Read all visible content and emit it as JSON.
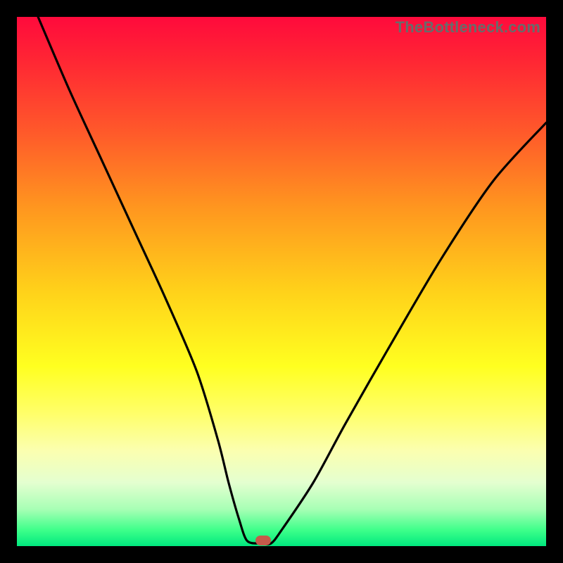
{
  "watermark": "TheBottleneck.com",
  "chart_data": {
    "type": "line",
    "title": "",
    "xlabel": "",
    "ylabel": "",
    "xlim": [
      0,
      100
    ],
    "ylim": [
      0,
      100
    ],
    "grid": false,
    "series": [
      {
        "name": "curve",
        "x": [
          4,
          10,
          16,
          22,
          28,
          34,
          38,
          40,
          42,
          43.5,
          46,
          48,
          50,
          56,
          62,
          70,
          80,
          90,
          100
        ],
        "values": [
          100,
          86,
          73,
          60,
          47,
          33,
          20,
          12,
          5,
          1,
          0.5,
          0.5,
          3,
          12,
          23,
          37,
          54,
          69,
          80
        ]
      }
    ],
    "marker": {
      "x": 46.5,
      "y_percent_from_top": 99,
      "color": "#c65a4a"
    },
    "gradient_stops": [
      {
        "pos": 0,
        "color": "#ff0a3c"
      },
      {
        "pos": 8,
        "color": "#ff2534"
      },
      {
        "pos": 22,
        "color": "#ff5a2a"
      },
      {
        "pos": 36,
        "color": "#ff961f"
      },
      {
        "pos": 52,
        "color": "#ffd21a"
      },
      {
        "pos": 66,
        "color": "#ffff20"
      },
      {
        "pos": 75,
        "color": "#ffff6a"
      },
      {
        "pos": 82,
        "color": "#fbffb0"
      },
      {
        "pos": 88,
        "color": "#e4ffd0"
      },
      {
        "pos": 93,
        "color": "#a8ffb5"
      },
      {
        "pos": 97,
        "color": "#3dff8a"
      },
      {
        "pos": 100,
        "color": "#00e87e"
      }
    ]
  }
}
